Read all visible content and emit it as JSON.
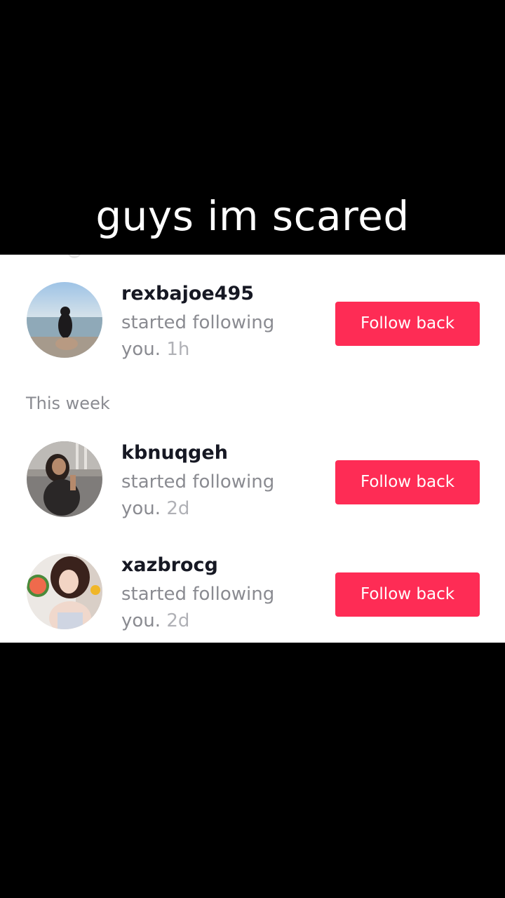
{
  "caption": "guys im scared",
  "sections": {
    "this_week_label": "This week"
  },
  "notifications": [
    {
      "username": "rexbajoe495",
      "line1": "started following",
      "line2": "you.",
      "time": "1h",
      "button_label": "Follow back",
      "avatar": "person-by-lake-avatar"
    },
    {
      "username": "kbnuqgeh",
      "line1": "started following",
      "line2": "you.",
      "time": "2d",
      "button_label": "Follow back",
      "avatar": "person-selfie-avatar"
    },
    {
      "username": "xazbrocg",
      "line1": "started following",
      "line2": "you.",
      "time": "2d",
      "button_label": "Follow back",
      "avatar": "person-with-fruit-avatar"
    }
  ],
  "colors": {
    "follow_button": "#fe2c55",
    "username": "#161823",
    "secondary_text": "#8a8b91",
    "background_outer": "#000000",
    "panel": "#ffffff"
  }
}
